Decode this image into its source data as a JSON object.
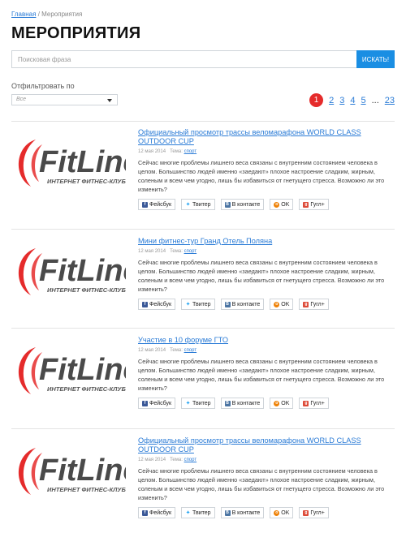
{
  "breadcrumb": {
    "home": "Главная",
    "separator": "/",
    "current": "Мероприятия"
  },
  "page_title": "МЕРОПРИЯТИЯ",
  "search": {
    "placeholder": "Поисковая фраза",
    "value": "",
    "button_label": "ИСКАТЬ!"
  },
  "filter": {
    "label": "Отфильтровать по",
    "selected": "Все"
  },
  "pagination": {
    "current": "1",
    "pages": [
      "2",
      "3",
      "4",
      "5"
    ],
    "ellipsis": "...",
    "last": "23"
  },
  "logo": {
    "brand": "FitLine",
    "subtitle": "ИНТЕРНЕТ ФИТНЕС-КЛУБ",
    "colors": {
      "red": "#e52b2b",
      "gray": "#555555"
    }
  },
  "share_labels": {
    "facebook": "Фейсбук",
    "twitter": "Твитер",
    "vk": "В контакте",
    "ok": "OK",
    "google": "Гугл+"
  },
  "items": [
    {
      "title": "Официальный просмотр трассы веломарафона WORLD CLASS OUTDOOR CUP",
      "date": "12 мая 2014",
      "theme_label": "Тема:",
      "theme": "спорт",
      "description": "Сейчас многие проблемы лишнего веса связаны с внутренним состоянием человека в целом. Большинство людей именно «заедают» плохое настроение сладким, жирным, соленым и всем чем угодно, лишь бы избавиться от гнетущего стресса. Возможно ли это изменить?"
    },
    {
      "title": "Мини фитнес-тур Гранд Отель Поляна",
      "date": "12 мая 2014",
      "theme_label": "Тема:",
      "theme": "спорт",
      "description": "Сейчас многие проблемы лишнего веса связаны с внутренним состоянием человека в целом. Большинство людей именно «заедают» плохое настроение сладким, жирным, соленым и всем чем угодно, лишь бы избавиться от гнетущего стресса. Возможно ли это изменить?"
    },
    {
      "title": "Участие в 10 форуме ГТО",
      "date": "12 мая 2014",
      "theme_label": "Тема:",
      "theme": "спорт",
      "description": "Сейчас многие проблемы лишнего веса связаны с внутренним состоянием человека в целом. Большинство людей именно «заедают» плохое настроение сладким, жирным, соленым и всем чем угодно, лишь бы избавиться от гнетущего стресса. Возможно ли это изменить?"
    },
    {
      "title": "Официальный просмотр трассы веломарафона WORLD CLASS OUTDOOR CUP",
      "date": "12 мая 2014",
      "theme_label": "Тема:",
      "theme": "спорт",
      "description": "Сейчас многие проблемы лишнего веса связаны с внутренним состоянием человека в целом. Большинство людей именно «заедают» плохое настроение сладким, жирным, соленым и всем чем угодно, лишь бы избавиться от гнетущего стресса. Возможно ли это изменить?"
    }
  ]
}
